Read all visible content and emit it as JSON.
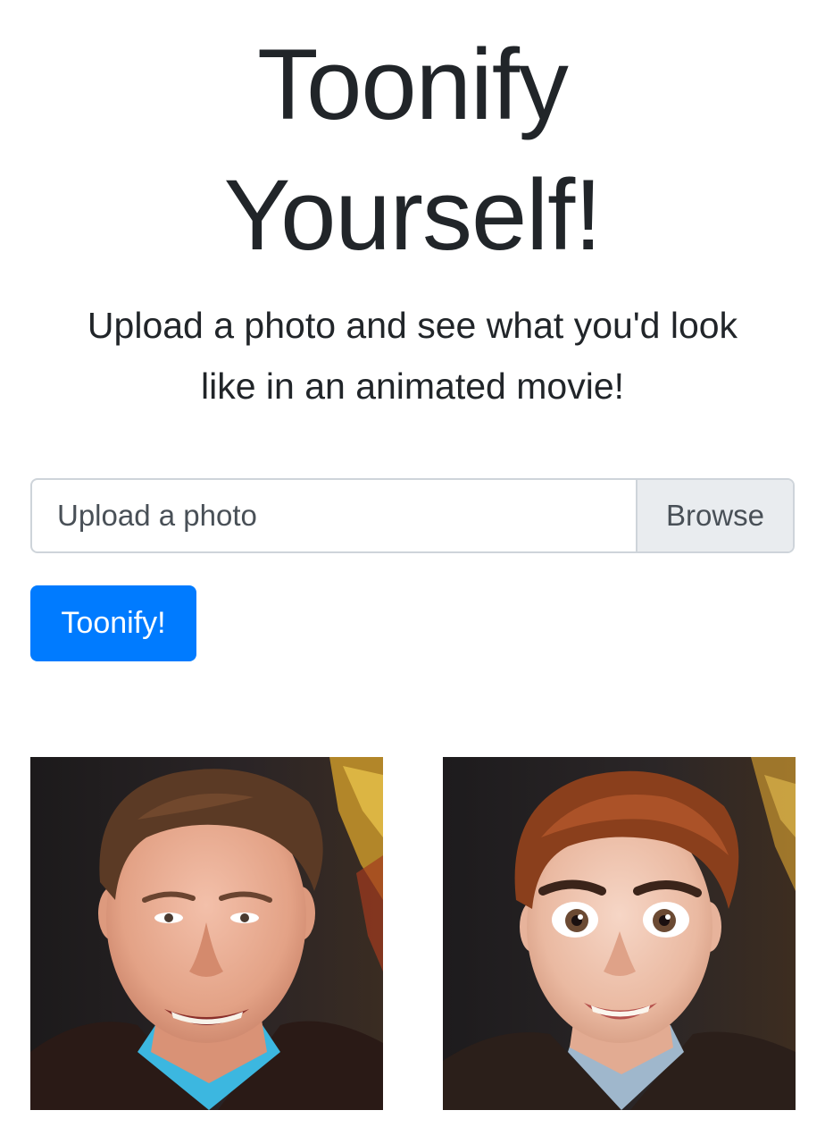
{
  "header": {
    "title_line1": "Toonify",
    "title_line2": "Yourself!",
    "subtitle_line1": "Upload a photo and see what you'd look",
    "subtitle_line2": "like in an animated movie!"
  },
  "upload": {
    "placeholder": "Upload a photo",
    "browse_label": "Browse"
  },
  "actions": {
    "submit_label": "Toonify!"
  },
  "colors": {
    "primary": "#007bff",
    "text": "#212529",
    "input_border": "#ced4da",
    "browse_bg": "#e9ecef"
  },
  "images": {
    "original": "original-photo",
    "toonified": "toonified-photo"
  }
}
